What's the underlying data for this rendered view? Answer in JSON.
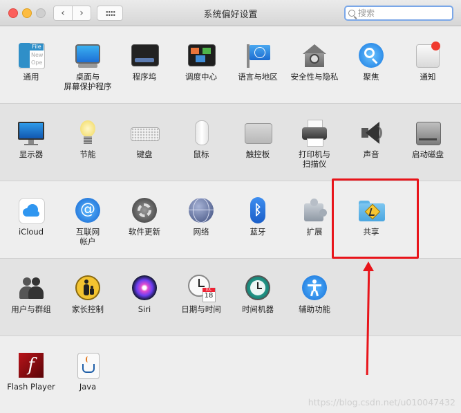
{
  "window": {
    "title": "系统偏好设置",
    "search_placeholder": "搜索",
    "back_glyph": "‹",
    "forward_glyph": "›"
  },
  "sections": [
    {
      "items": [
        {
          "label": "通用",
          "icon": "general-icon"
        },
        {
          "label": "桌面与\n屏幕保护程序",
          "icon": "desktop-screensaver-icon"
        },
        {
          "label": "程序坞",
          "icon": "dock-icon"
        },
        {
          "label": "调度中心",
          "icon": "mission-control-icon"
        },
        {
          "label": "语言与地区",
          "icon": "language-region-icon"
        },
        {
          "label": "安全性与隐私",
          "icon": "security-privacy-icon"
        },
        {
          "label": "聚焦",
          "icon": "spotlight-icon"
        },
        {
          "label": "通知",
          "icon": "notifications-icon"
        }
      ]
    },
    {
      "items": [
        {
          "label": "显示器",
          "icon": "displays-icon"
        },
        {
          "label": "节能",
          "icon": "energy-saver-icon"
        },
        {
          "label": "键盘",
          "icon": "keyboard-icon"
        },
        {
          "label": "鼠标",
          "icon": "mouse-icon"
        },
        {
          "label": "触控板",
          "icon": "trackpad-icon"
        },
        {
          "label": "打印机与\n扫描仪",
          "icon": "printers-scanners-icon"
        },
        {
          "label": "声音",
          "icon": "sound-icon"
        },
        {
          "label": "启动磁盘",
          "icon": "startup-disk-icon"
        }
      ]
    },
    {
      "items": [
        {
          "label": "iCloud",
          "icon": "icloud-icon"
        },
        {
          "label": "互联网\n帐户",
          "icon": "internet-accounts-icon"
        },
        {
          "label": "软件更新",
          "icon": "software-update-icon"
        },
        {
          "label": "网络",
          "icon": "network-icon"
        },
        {
          "label": "蓝牙",
          "icon": "bluetooth-icon"
        },
        {
          "label": "扩展",
          "icon": "extensions-icon"
        },
        {
          "label": "共享",
          "icon": "sharing-icon"
        }
      ]
    },
    {
      "items": [
        {
          "label": "用户与群组",
          "icon": "users-groups-icon"
        },
        {
          "label": "家长控制",
          "icon": "parental-controls-icon"
        },
        {
          "label": "Siri",
          "icon": "siri-icon"
        },
        {
          "label": "日期与时间",
          "icon": "date-time-icon"
        },
        {
          "label": "时间机器",
          "icon": "time-machine-icon"
        },
        {
          "label": "辅助功能",
          "icon": "accessibility-icon"
        }
      ]
    },
    {
      "items": [
        {
          "label": "Flash Player",
          "icon": "flash-player-icon"
        },
        {
          "label": "Java",
          "icon": "java-icon"
        }
      ]
    }
  ],
  "icon_text": {
    "general_file": "File",
    "general_new": "New",
    "general_ope": "Ope",
    "calendar_month": "JUL",
    "calendar_day": "18",
    "flash_glyph": "f"
  },
  "watermark": "https://blog.csdn.net/u010047432",
  "colors": {
    "annotation": "#e8141a",
    "accent": "#3a8ef0"
  }
}
